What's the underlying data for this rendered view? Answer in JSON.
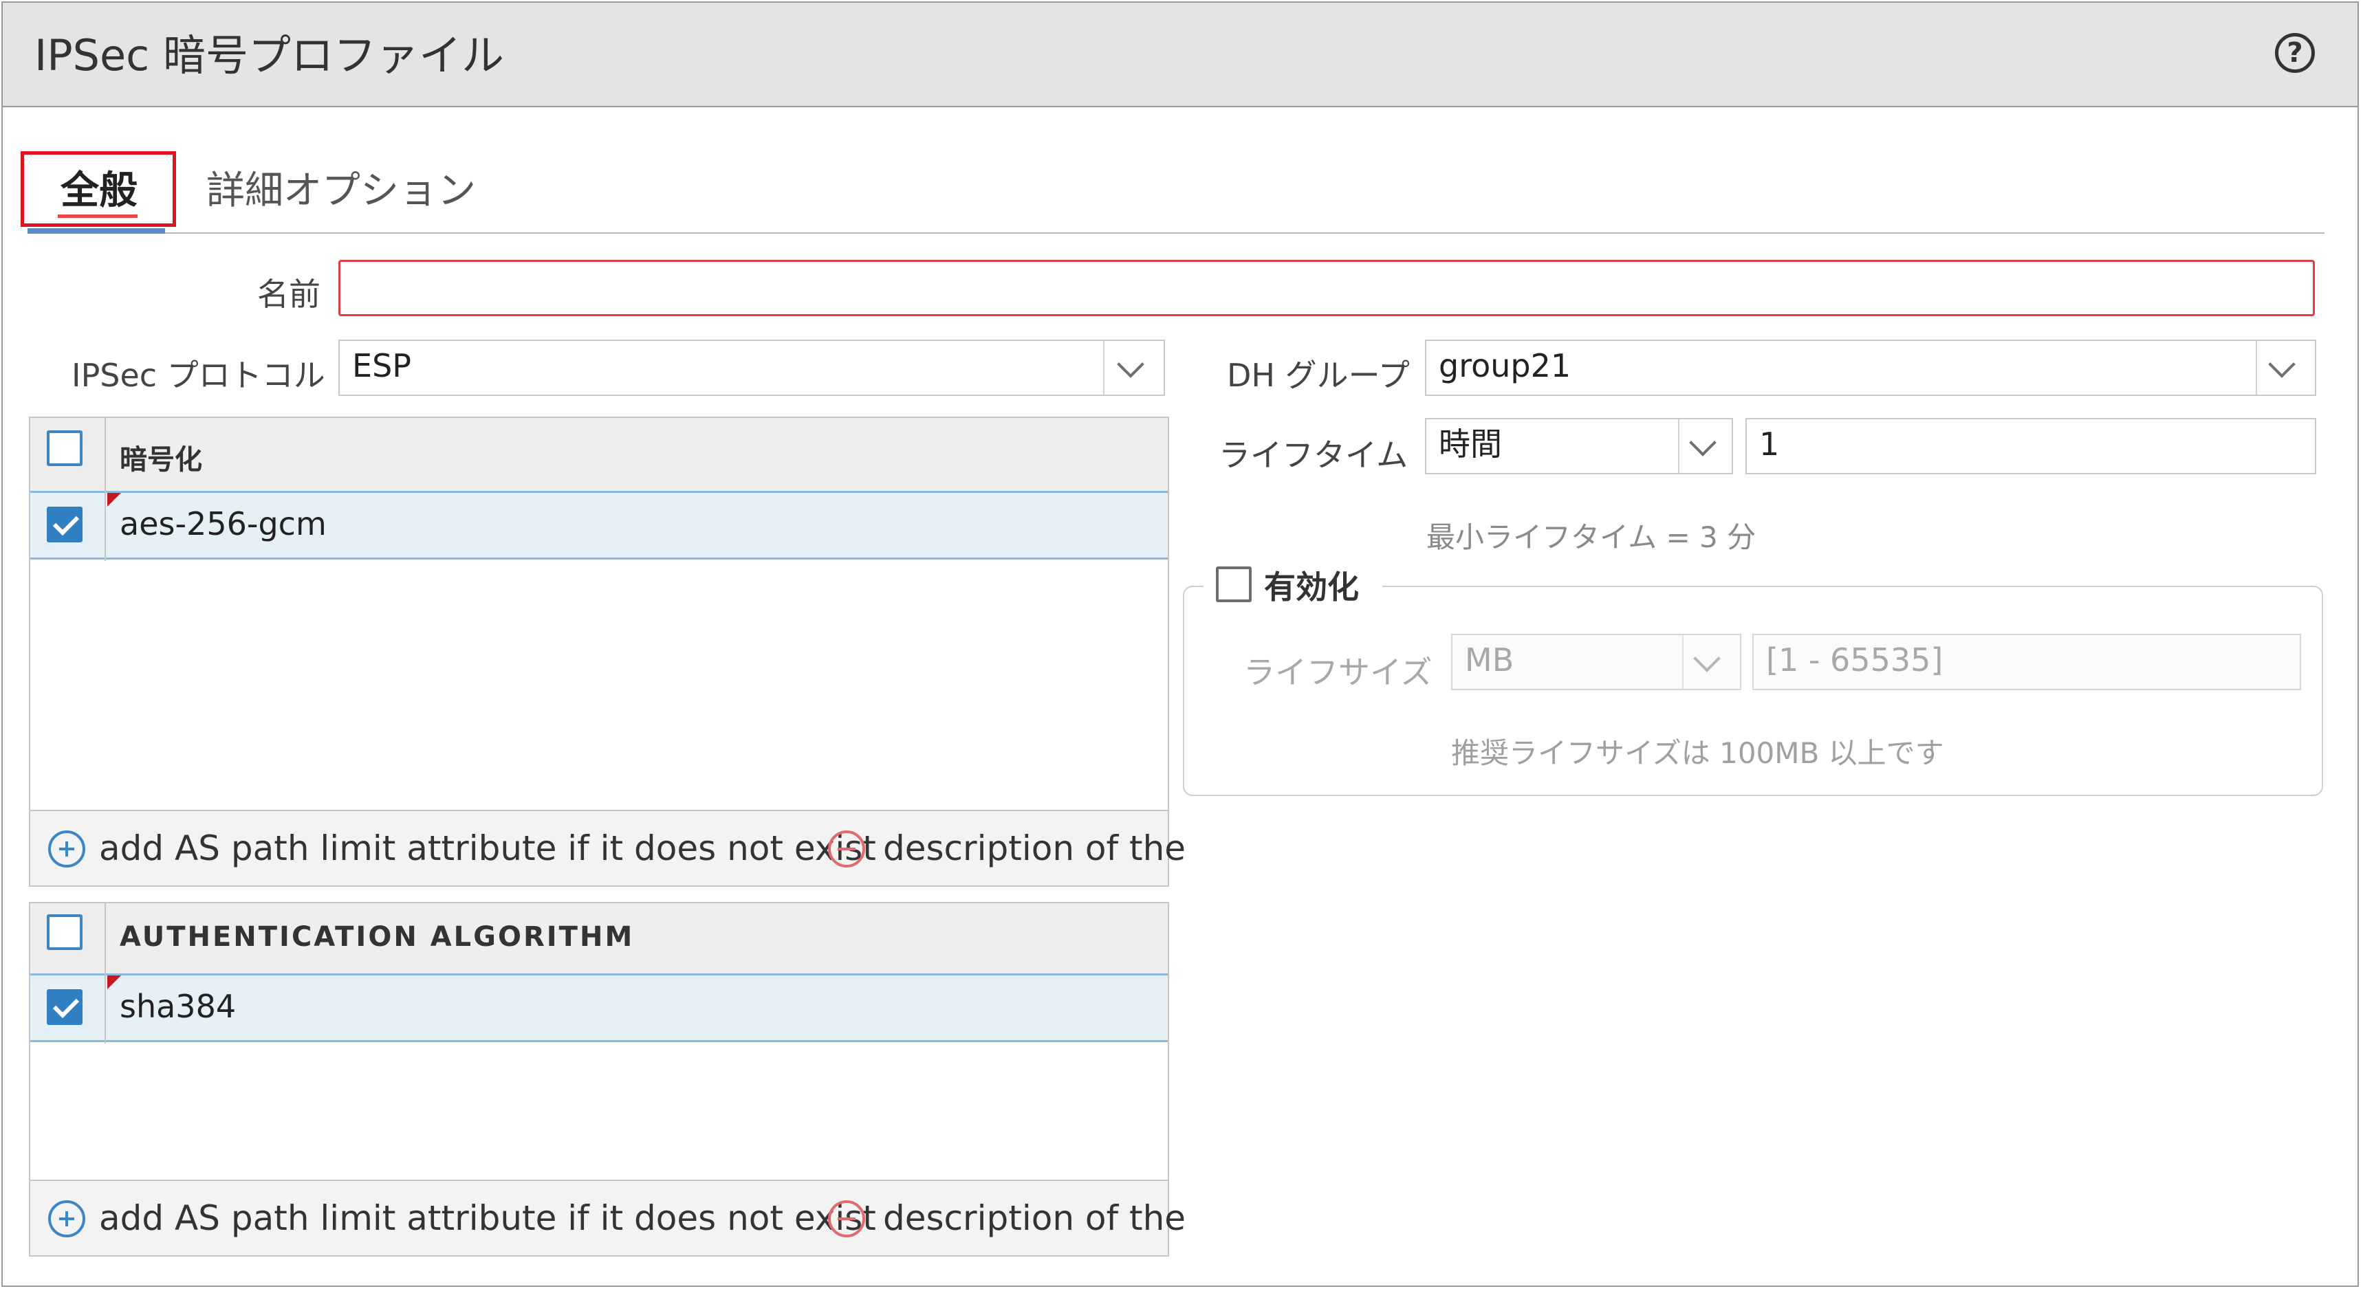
{
  "dialog": {
    "title": "IPSec 暗号プロファイル",
    "help_icon": "question-circle-icon"
  },
  "tabs": [
    {
      "label": "全般",
      "active": true
    },
    {
      "label": "詳細オプション",
      "active": false
    }
  ],
  "form": {
    "name_label": "名前",
    "name_value": "",
    "protocol_label": "IPSec プロトコル",
    "protocol_value": "ESP",
    "dh_group_label": "DH グループ",
    "dh_group_value": "group21",
    "lifetime_label": "ライフタイム",
    "lifetime_unit": "時間",
    "lifetime_value": "1",
    "lifetime_hint": "最小ライフタイム = 3 分",
    "enable_label": "有効化",
    "enable_checked": false,
    "lifesize_label": "ライフサイズ",
    "lifesize_unit": "MB",
    "lifesize_placeholder": "[1 - 65535]",
    "lifesize_hint": "推奨ライフサイズは 100MB 以上です"
  },
  "encryption_grid": {
    "header": "暗号化",
    "rows": [
      {
        "value": "aes-256-gcm",
        "checked": true
      }
    ],
    "add_label": "add AS path limit attribute if it does not exist",
    "delete_label": "description of the"
  },
  "auth_grid": {
    "header": "AUTHENTICATION ALGORITHM",
    "rows": [
      {
        "value": "sha384",
        "checked": true
      }
    ],
    "add_label": "add AS path limit attribute if it does not exist",
    "delete_label": "description of the"
  },
  "colors": {
    "accent_blue": "#2f7fc1",
    "error_red": "#e23b41",
    "title_bar": "#e3e4e6"
  }
}
